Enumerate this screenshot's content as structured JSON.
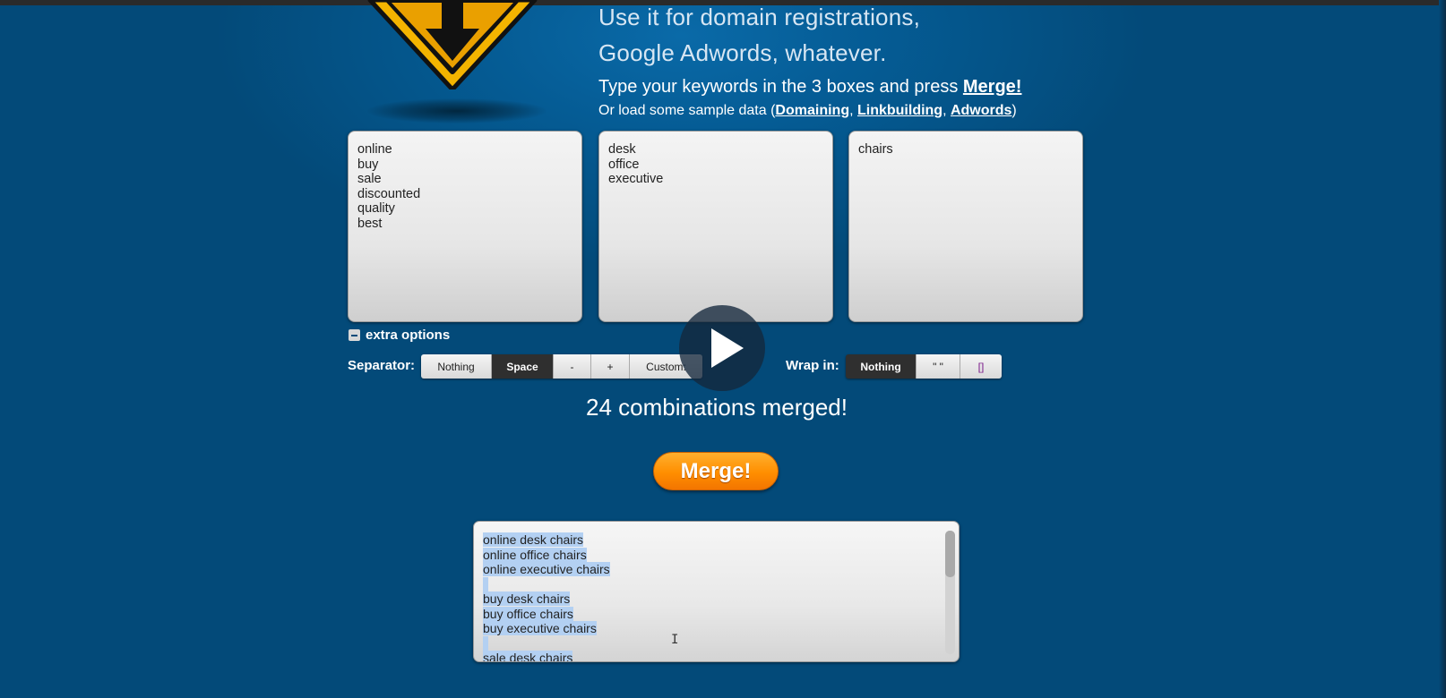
{
  "header": {
    "line1": "Use it for domain registrations,",
    "line2": "Google Adwords, whatever.",
    "instruction_prefix": "Type your keywords in the 3 boxes and press ",
    "instruction_link": "Merge!",
    "samples_prefix": "Or load some sample data (",
    "samples": [
      "Domaining",
      "Linkbuilding",
      "Adwords"
    ],
    "samples_sep": ", ",
    "samples_suffix": ")"
  },
  "boxes": [
    [
      "online",
      "buy",
      "sale",
      "discounted",
      "quality",
      "best"
    ],
    [
      "desk",
      "office",
      "executive"
    ],
    [
      "chairs"
    ]
  ],
  "options": {
    "toggle_label": "extra options",
    "separator_label": "Separator:",
    "separator_buttons": [
      "Nothing",
      "Space",
      "-",
      "+",
      "Custom:"
    ],
    "separator_active": "Space",
    "wrap_label": "Wrap in:",
    "wrap_buttons": [
      "Nothing",
      "\" \"",
      "[]"
    ],
    "wrap_active": "Nothing"
  },
  "result": {
    "count_text": "24 combinations merged!",
    "merge_button": "Merge!",
    "output_lines": [
      "online desk chairs",
      "online office chairs",
      "online executive chairs",
      "",
      "buy desk chairs",
      "buy office chairs",
      "buy executive chairs",
      "",
      "sale desk chairs"
    ]
  },
  "colors": {
    "background": "#034a79",
    "merge_button": "#ff8e00",
    "active_segment": "#2f2f2f",
    "selection": "#b3d0f2"
  },
  "icons": [
    "warning-sign-logo-icon",
    "minus-icon",
    "play-icon",
    "text-cursor-icon"
  ]
}
